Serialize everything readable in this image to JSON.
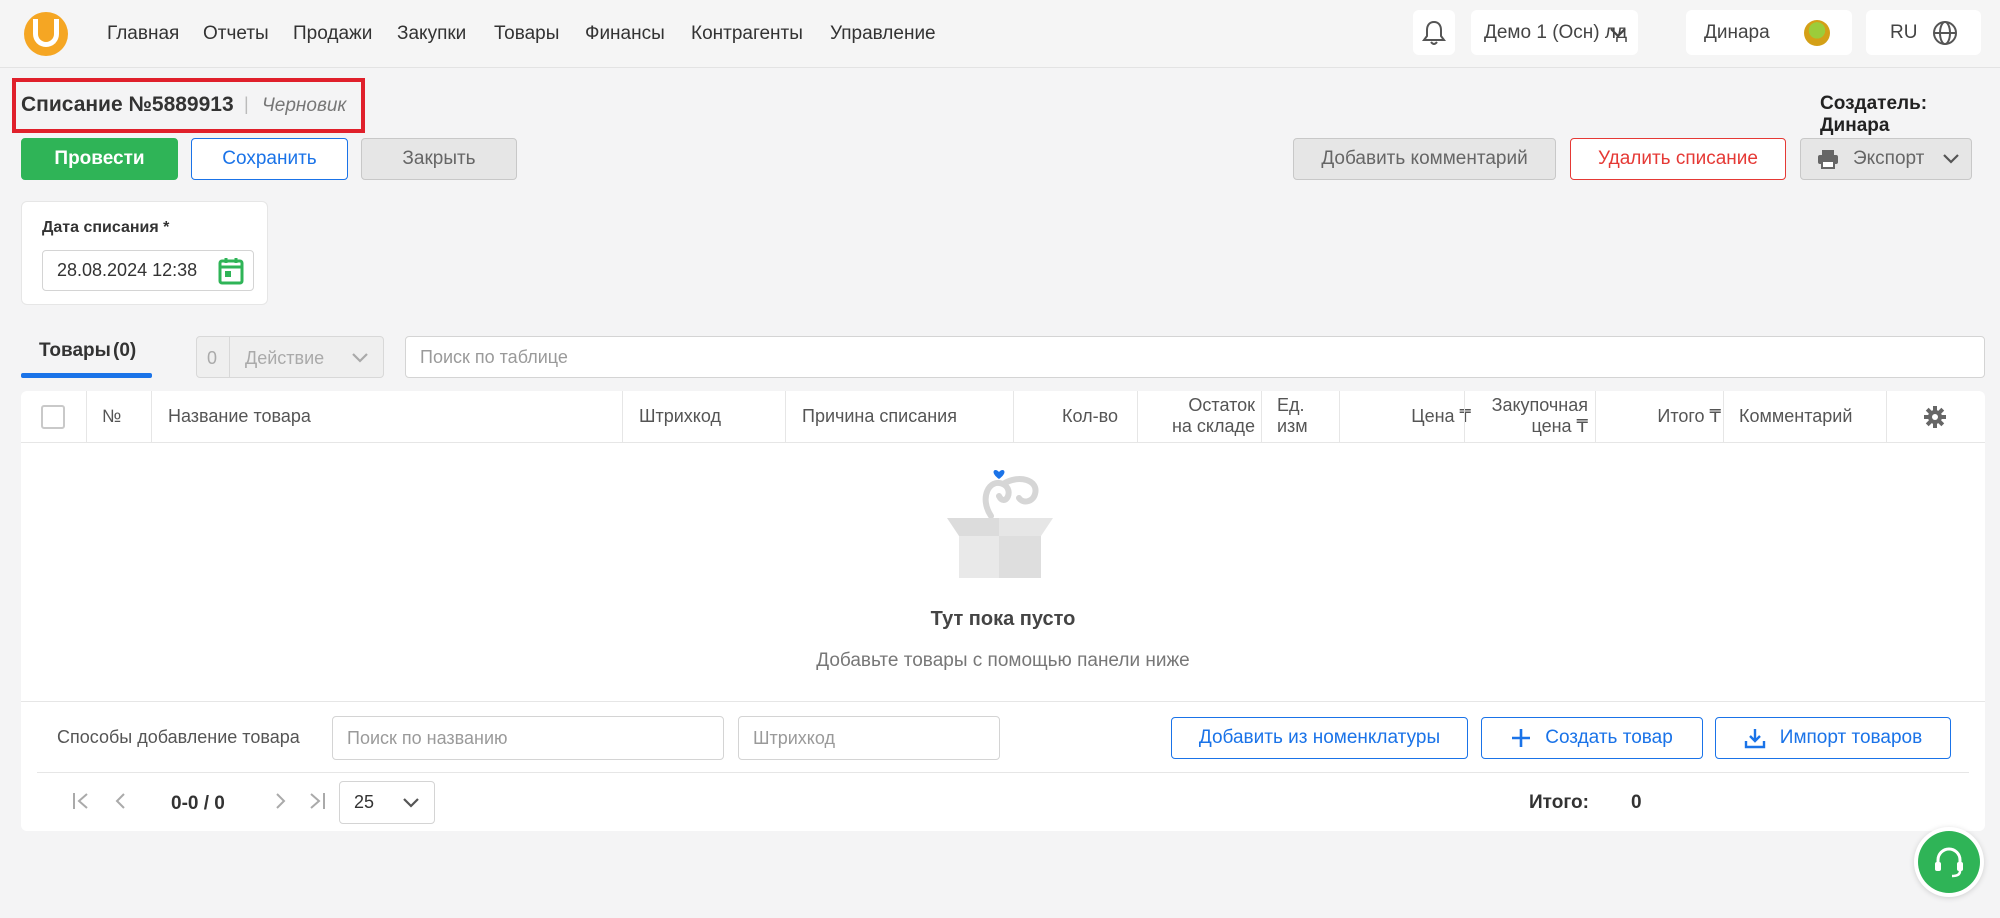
{
  "nav": {
    "items": [
      "Главная",
      "Отчеты",
      "Продажи",
      "Закупки",
      "Товары",
      "Финансы",
      "Контрагенты",
      "Управление"
    ],
    "company": "Демо 1 (Осн) лд",
    "user": "Динара",
    "language": "RU"
  },
  "doc": {
    "title": "Списание №5889913",
    "status": "Черновик",
    "creator_label": "Создатель: Динара"
  },
  "toolbar": {
    "post": "Провести",
    "save": "Сохранить",
    "close": "Закрыть",
    "add_comment": "Добавить комментарий",
    "delete": "Удалить списание",
    "export": "Экспорт"
  },
  "date_field": {
    "label": "Дата списания *",
    "value": "28.08.2024 12:38"
  },
  "tabs": {
    "goods": "Товары",
    "goods_count": "(0)"
  },
  "action": {
    "count": "0",
    "label": "Действие"
  },
  "table_search": {
    "placeholder": "Поиск по таблице"
  },
  "table": {
    "columns": {
      "num": "№",
      "name": "Название товара",
      "barcode": "Штрихкод",
      "reason": "Причина списания",
      "qty": "Кол-во",
      "stock_1": "Остаток",
      "stock_2": "на складе",
      "unit_1": "Ед.",
      "unit_2": "изм",
      "price": "Цена ₸",
      "purchase_1": "Закупочная",
      "purchase_2": "цена ₸",
      "total": "Итого ₸",
      "comment": "Комментарий"
    },
    "empty_title": "Тут пока пусто",
    "empty_subtitle": "Добавьте товары с помощью панели ниже"
  },
  "add_panel": {
    "label": "Способы добавление товара",
    "name_placeholder": "Поиск по названию",
    "barcode_placeholder": "Штрихкод",
    "from_catalog": "Добавить из номенклатуры",
    "create": "Создать товар",
    "import": "Импорт товаров"
  },
  "pagination": {
    "range": "0-0 / 0",
    "page_size": "25",
    "total_label": "Итого:",
    "total_value": "0"
  },
  "colors": {
    "accent_green": "#2fb457",
    "accent_blue": "#1a73e8",
    "danger_red": "#e53935",
    "logo_orange": "#f5a623",
    "highlight_box": "#e0202b"
  }
}
